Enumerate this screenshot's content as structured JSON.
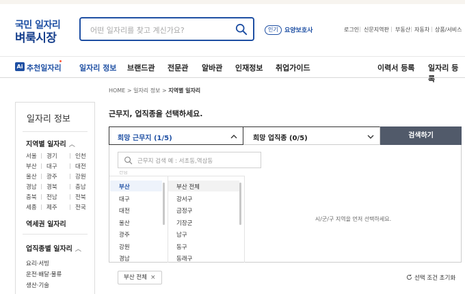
{
  "header": {
    "logo_line1": "국민 일자리",
    "logo_line2": "벼룩시장",
    "search_placeholder": "어떤 일자리를 찾고 계신가요?",
    "popular_badge": "인기",
    "popular_keyword": "요양보호사",
    "util_links": [
      "로그인",
      "신문지역판",
      "부동산",
      "자동차",
      "상품/서비스"
    ]
  },
  "nav": {
    "ai_badge": "Ai",
    "ai_label": "추천일자리",
    "items": [
      "일자리 정보",
      "브랜드관",
      "전문관",
      "알바관",
      "인재정보",
      "취업가이드"
    ],
    "right_items": [
      "이력서 등록",
      "일자리 등록"
    ]
  },
  "breadcrumb": {
    "home": "HOME",
    "sep": ">",
    "mid": "일자리 정보",
    "current": "지역별 일자리"
  },
  "sidebar": {
    "title": "일자리 정보",
    "region_heading": "지역별 일자리",
    "caret": "︿",
    "regions": [
      [
        "서울",
        "경기",
        "인천"
      ],
      [
        "부산",
        "대구",
        "대전"
      ],
      [
        "울산",
        "광주",
        "강원"
      ],
      [
        "경남",
        "경북",
        "충남"
      ],
      [
        "충북",
        "전남",
        "전북"
      ],
      [
        "세종",
        "제주",
        "전국"
      ]
    ],
    "station_heading": "역세권 일자리",
    "job_heading": "업직종별 일자리",
    "jobs": [
      "요리·서빙",
      "운전·배달·물류",
      "생산·기술"
    ]
  },
  "main": {
    "title": "근무지, 업직종을 선택하세요.",
    "select_location": "희망 근무지 (1/5)",
    "select_job": "희망 업직종 (0/5)",
    "search_button": "검색하기",
    "panel_search_placeholder": "근무지 검색 예 : 서초동,역삼동",
    "regions_partial": "전남",
    "region_list": [
      "부산",
      "대구",
      "대전",
      "울산",
      "광주",
      "강원",
      "경남"
    ],
    "district_list": [
      "부산 전체",
      "강서구",
      "금정구",
      "기장군",
      "남구",
      "동구",
      "동래구"
    ],
    "right_hint": "시/군/구 지역을 먼저 선택하세요.",
    "chip_label": "부산 전체",
    "chip_x": "×",
    "reset_label": "선택 조건 초기화"
  },
  "colors": {
    "brand_blue": "#1e4fa3",
    "search_button_bg": "#515a6a",
    "ai_dot": "#ff5a3c"
  }
}
